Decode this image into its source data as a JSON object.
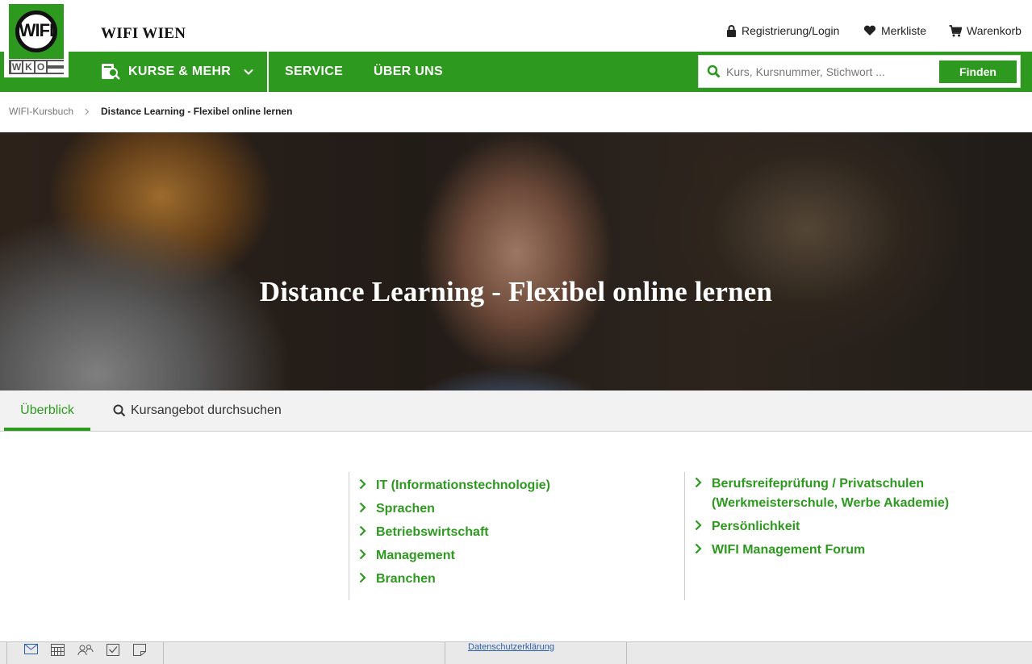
{
  "brand": {
    "logo_text": "WIFI",
    "logo_sub": [
      "W",
      "K",
      "O"
    ],
    "name": "WIFI WIEN"
  },
  "utility_nav": {
    "login": "Registrierung/Login",
    "wishlist": "Merkliste",
    "cart": "Warenkorb"
  },
  "main_nav": {
    "courses": "KURSE & MEHR",
    "service": "SERVICE",
    "about": "ÜBER UNS"
  },
  "search": {
    "placeholder": "Kurs, Kursnummer, Stichwort ...",
    "button": "Finden"
  },
  "breadcrumb": {
    "home": "WIFI-Kursbuch",
    "current": "Distance Learning - Flexibel online lernen"
  },
  "hero": {
    "title": "Distance Learning - Flexibel online lernen"
  },
  "tabs": {
    "overview": "Überblick",
    "search_courses": "Kursangebot durchsuchen"
  },
  "categories": {
    "left": [
      "IT (Informationstechnologie)",
      "Sprachen",
      "Betriebswirtschaft",
      "Management",
      "Branchen"
    ],
    "right": [
      "Berufsreifeprüfung / Privatschulen (Werkmeisterschule, Werbe Akademie)",
      "Persönlichkeit",
      "WIFI Management Forum"
    ]
  },
  "taskbar": {
    "link": "Datenschutzerklärung"
  },
  "colors": {
    "brand_green": "#2d9a1f"
  }
}
